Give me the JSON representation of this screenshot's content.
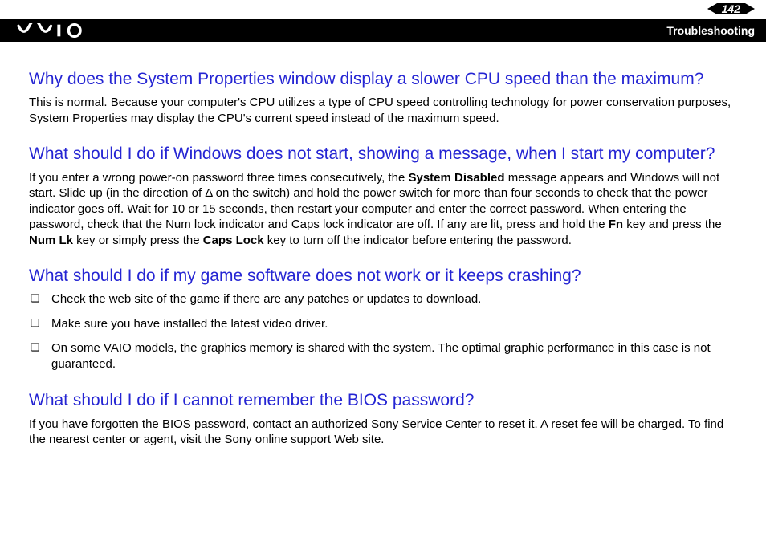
{
  "header": {
    "page_number": "142",
    "section": "Troubleshooting"
  },
  "sections": {
    "s1": {
      "q": "Why does the System Properties window display a slower CPU speed than the maximum?",
      "a": "This is normal. Because your computer's CPU utilizes a type of CPU speed controlling technology for power conservation purposes, System Properties may display the CPU's current speed instead of the maximum speed."
    },
    "s2": {
      "q": "What should I do if Windows does not start, showing a message, when I start my computer?",
      "a_pre": "If you enter a wrong power-on password three times consecutively, the ",
      "a_bold1": "System Disabled",
      "a_mid1": " message appears and Windows will not start. Slide up (in the direction of Δ on the switch) and hold the power switch for more than four seconds to check that the power indicator goes off. Wait for 10 or 15 seconds, then restart your computer and enter the correct password. When entering the password, check that the Num lock indicator and Caps lock indicator are off. If any are lit, press and hold the ",
      "a_bold2": "Fn",
      "a_mid2": " key and press the ",
      "a_bold3": "Num Lk",
      "a_mid3": " key or simply press the ",
      "a_bold4": "Caps Lock",
      "a_post": " key to turn off the indicator before entering the password."
    },
    "s3": {
      "q": "What should I do if my game software does not work or it keeps crashing?",
      "bullets": [
        "Check the web site of the game if there are any patches or updates to download.",
        "Make sure you have installed the latest video driver.",
        "On some VAIO models, the graphics memory is shared with the system. The optimal graphic performance in this case is not guaranteed."
      ]
    },
    "s4": {
      "q": "What should I do if I cannot remember the BIOS password?",
      "a": "If you have forgotten the BIOS password, contact an authorized Sony Service Center to reset it. A reset fee will be charged. To find the nearest center or agent, visit the Sony online support Web site."
    }
  }
}
